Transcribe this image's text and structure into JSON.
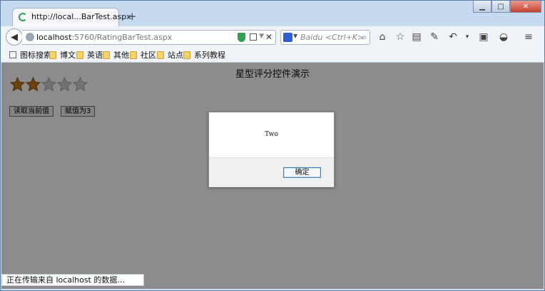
{
  "browser": {
    "tab_title": "http://local...BarTest.aspx",
    "new_tab_symbol": "+",
    "url_host": "localhost",
    "url_rest": ":5760/RatingBarTest.aspx",
    "search_placeholder": "Baidu <Ctrl+K>",
    "window_controls": [
      "minimize",
      "maximize",
      "close"
    ],
    "toolbar_icons": [
      "home-icon",
      "star-icon",
      "clipboard-icon",
      "wrench-icon",
      "undo-icon",
      "dropdown-icon",
      "reader-icon",
      "headset-icon",
      "menu-icon"
    ]
  },
  "bookmarks": [
    {
      "label": "图标搜索",
      "icon": "square-icon"
    },
    {
      "label": "博文",
      "icon": "folder-icon"
    },
    {
      "label": "英语",
      "icon": "folder-icon"
    },
    {
      "label": "其他",
      "icon": "folder-icon"
    },
    {
      "label": "社区",
      "icon": "folder-icon"
    },
    {
      "label": "站点",
      "icon": "folder-icon"
    },
    {
      "label": "系列教程",
      "icon": "folder-icon"
    }
  ],
  "page": {
    "title": "星型评分控件演示",
    "rating": {
      "value": 2,
      "max": 5,
      "filled_color": "#c47a1c",
      "empty_color": "#d0d0d0"
    },
    "buttons": {
      "read_label": "读取当前值",
      "set_label": "赋值为3"
    }
  },
  "dialog": {
    "message": "Two",
    "ok_label": "确定"
  },
  "status": {
    "text": "正在传输来自 localhost 的数据..."
  }
}
